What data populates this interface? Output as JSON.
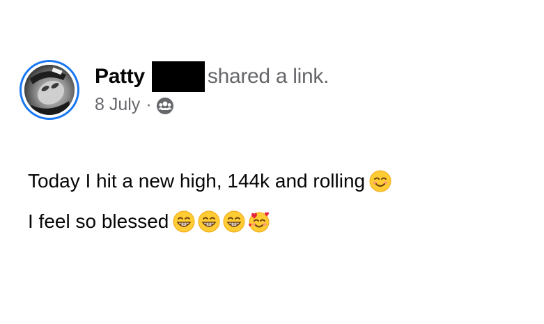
{
  "post": {
    "author_name": "Patty",
    "action_text": "shared a link.",
    "date": "8 July",
    "separator": "·",
    "audience_icon": "friends-icon",
    "lines": [
      {
        "text": "Today I hit a new high, 144k and rolling",
        "emojis": [
          "smiling-face-with-smiling-eyes"
        ]
      },
      {
        "text": "I feel so blessed",
        "emojis": [
          "beaming-face-with-smiling-eyes",
          "beaming-face-with-smiling-eyes",
          "beaming-face-with-smiling-eyes",
          "smiling-face-with-hearts"
        ]
      }
    ]
  },
  "colors": {
    "avatar_ring": "#1877f2",
    "secondary_text": "#65676b",
    "primary_text": "#050505",
    "redaction": "#000000"
  }
}
